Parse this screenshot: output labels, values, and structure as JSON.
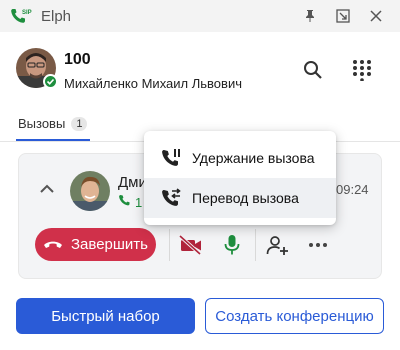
{
  "window": {
    "title": "Elph",
    "app_icon_label": "SIP"
  },
  "user": {
    "extension": "100",
    "full_name": "Михайленко Михаил Львович",
    "status": "online"
  },
  "tabs": [
    {
      "label": "Вызовы",
      "count": "1",
      "active": true
    }
  ],
  "call": {
    "caller_name_visible": "Дми",
    "caller_number_visible": "1",
    "time": "09:24"
  },
  "actions": {
    "end_call_label": "Завершить"
  },
  "menu": {
    "items": [
      {
        "label": "Удержание вызова",
        "icon": "phone-hold-icon"
      },
      {
        "label": "Перевод вызова",
        "icon": "phone-transfer-icon",
        "highlighted": true
      }
    ]
  },
  "footer": {
    "quick_dial_label": "Быстрый набор",
    "conference_label": "Создать конференцию"
  },
  "colors": {
    "accent": "#2a5bd7",
    "end_call": "#d0304a",
    "online": "#1e8e3e",
    "video_off": "#b0243b",
    "mic": "#1e8e3e"
  }
}
